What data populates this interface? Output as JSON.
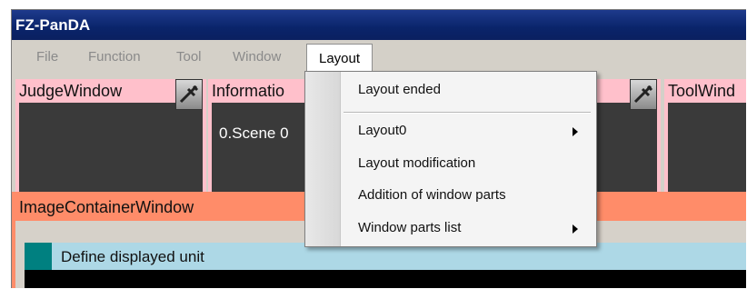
{
  "window": {
    "title": "FZ-PanDA"
  },
  "menubar": {
    "items": [
      "File",
      "Function",
      "Tool",
      "Window",
      "Layout"
    ],
    "active": "Layout"
  },
  "panels": {
    "judge": {
      "title": "JudgeWindow"
    },
    "information": {
      "title": "Informatio",
      "text": "0.Scene 0"
    },
    "tool": {
      "title": "ToolWind"
    }
  },
  "image_container": {
    "title": "ImageContainerWindow",
    "unit_label": "Define displayed unit"
  },
  "layout_menu": {
    "items": [
      {
        "label": "Layout ended",
        "submenu": false
      },
      {
        "label": "Layout0",
        "submenu": true
      },
      {
        "label": "Layout modification",
        "submenu": false
      },
      {
        "label": "Addition of window parts",
        "submenu": false
      },
      {
        "label": "Window parts list",
        "submenu": true
      }
    ]
  },
  "colors": {
    "title_bar": "#0a246a",
    "panel_border": "#ffc0cb",
    "image_container": "#ff8c69",
    "unit_bar": "#add8e6",
    "unit_swatch": "#008080",
    "panel_body": "#3a3a3a"
  },
  "icons": {
    "panel_settings": "wrench-icon",
    "submenu": "triangle-right-icon"
  }
}
